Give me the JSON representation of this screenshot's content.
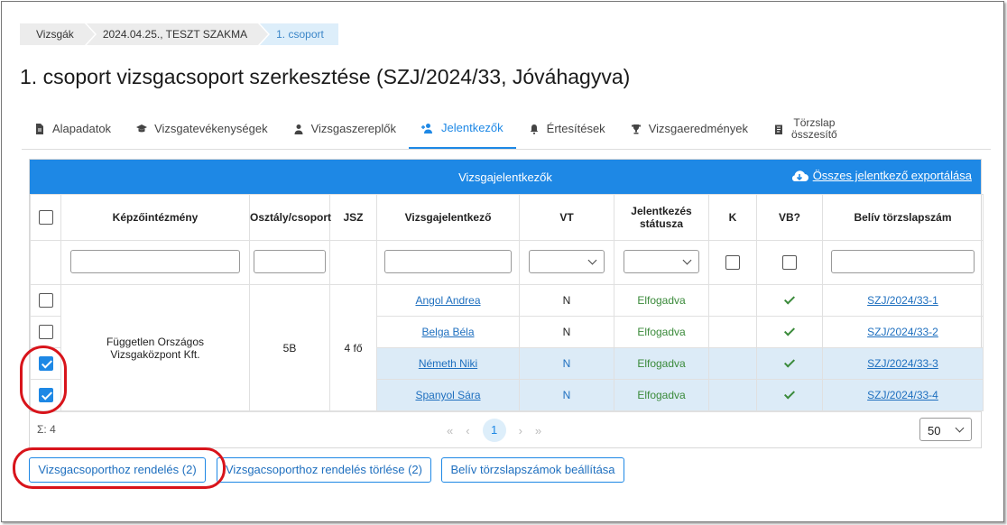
{
  "breadcrumb": [
    "Vizsgák",
    "2024.04.25., TESZT SZAKMA",
    "1. csoport"
  ],
  "page_title": "1. csoport vizsgacsoport szerkesztése (SZJ/2024/33, Jóváhagyva)",
  "tabs": [
    {
      "label": "Alapadatok",
      "icon": "document-icon"
    },
    {
      "label": "Vizsgatevékenységek",
      "icon": "graduation-cap-icon"
    },
    {
      "label": "Vizsgaszereplők",
      "icon": "person-icon"
    },
    {
      "label": "Jelentkezők",
      "icon": "person-add-icon",
      "active": true
    },
    {
      "label": "Értesítések",
      "icon": "bell-icon"
    },
    {
      "label": "Vizsgaeredmények",
      "icon": "trophy-icon"
    },
    {
      "label_line1": "Törzslap",
      "label_line2": "összesítő",
      "icon": "clipboard-icon"
    }
  ],
  "grid": {
    "title": "Vizsgajelentkezők",
    "export_label": "Összes jelentkező exportálása",
    "columns": [
      "Képzőintézmény",
      "Osztály/csoport",
      "JSZ",
      "Vizsgajelentkező",
      "VT",
      "Jelentkezés státusza",
      "K",
      "VB?",
      "Belív törzslapszám"
    ],
    "columns_split": {
      "status_line1": "Jelentkezés",
      "status_line2": "státusza"
    },
    "group": {
      "institution_line1": "Független Országos",
      "institution_line2": "Vizsgaközpont Kft.",
      "class": "5B",
      "jsz": "4 fő"
    },
    "rows": [
      {
        "name": "Angol Andrea",
        "vt": "N",
        "status": "Elfogadva",
        "serial": "SZJ/2024/33-1",
        "checked": false
      },
      {
        "name": "Belga Béla",
        "vt": "N",
        "status": "Elfogadva",
        "serial": "SZJ/2024/33-2",
        "checked": false
      },
      {
        "name": "Németh Niki",
        "vt": "N",
        "status": "Elfogadva",
        "serial": "SZJ/2024/33-3",
        "checked": true
      },
      {
        "name": "Spanyol Sára",
        "vt": "N",
        "status": "Elfogadva",
        "serial": "SZJ/2024/33-4",
        "checked": true
      }
    ],
    "footer": {
      "sum": "Σ: 4",
      "page": "1",
      "page_size": "50"
    }
  },
  "buttons": {
    "assign": "Vizsgacsoporthoz rendelés (2)",
    "unassign": "Vizsgacsoporthoz rendelés törlése (2)",
    "set_serials": "Belív törzslapszámok beállítása"
  },
  "colors": {
    "accent": "#1e88e5",
    "selected_row": "#dcebf7",
    "status_green": "#3a8a3a",
    "highlight_ring": "#d8141b"
  }
}
